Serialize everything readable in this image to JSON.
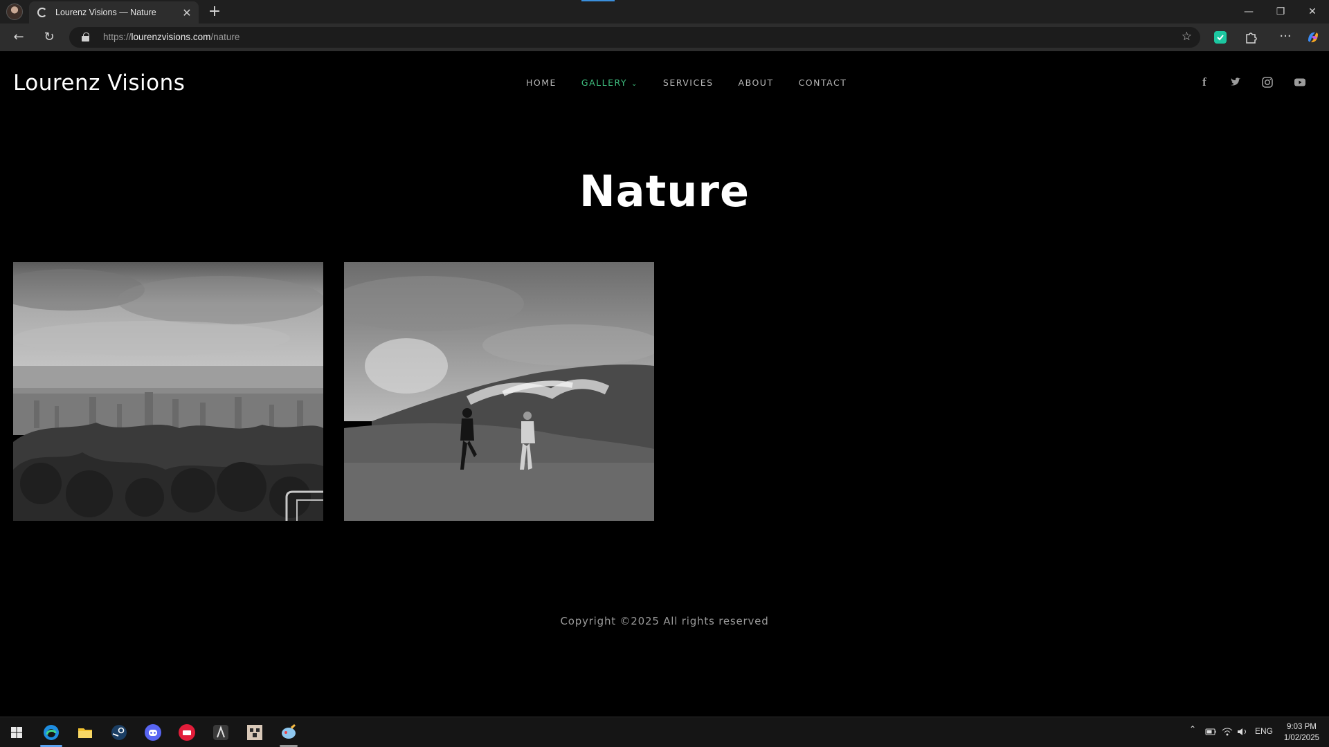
{
  "browser": {
    "tab_title": "Lourenz Visions — Nature",
    "url_scheme": "https://",
    "url_host": "lourenzvisions.com",
    "url_path": "/nature",
    "icons": [
      "profile-avatar",
      "tab-favicon",
      "close-icon",
      "plus-icon",
      "back-icon",
      "refresh-icon",
      "lock-icon",
      "star-icon",
      "extension-icon",
      "puzzle-icon",
      "more-icon",
      "copilot-icon",
      "minimize-icon",
      "restore-icon",
      "window-close-icon"
    ]
  },
  "site": {
    "logo": "Lourenz Visions",
    "nav": [
      {
        "label": "HOME",
        "active": false
      },
      {
        "label": "GALLERY",
        "active": true
      },
      {
        "label": "SERVICES",
        "active": false
      },
      {
        "label": "ABOUT",
        "active": false
      },
      {
        "label": "CONTACT",
        "active": false
      }
    ],
    "social": [
      "facebook-icon",
      "twitter-icon",
      "instagram-icon",
      "youtube-icon"
    ],
    "page_title": "Nature",
    "photos": [
      {
        "subject": "city skyline viewed from forested hilltop (grayscale)"
      },
      {
        "subject": "two people on grassy field with clouded hills (grayscale)"
      }
    ],
    "copyright": "Copyright ©2025 All rights reserved",
    "accent_color": "#3fbf7f"
  },
  "taskbar": {
    "apps": [
      "windows-start-icon",
      "edge-icon",
      "file-explorer-icon",
      "steam-icon",
      "discord-icon",
      "app-red-icon",
      "app-dark-icon",
      "app-pixel-icon",
      "app-paint-icon"
    ],
    "language": "ENG",
    "time": "9:03 PM",
    "date": "1/02/2025"
  }
}
